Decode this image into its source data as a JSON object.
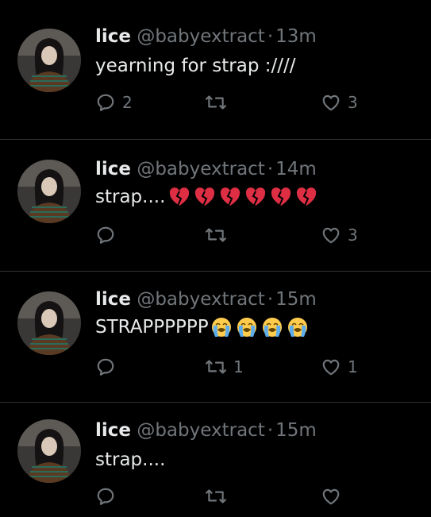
{
  "colors": {
    "background": "#000000",
    "text": "#e7e9ea",
    "muted": "#71767b",
    "divider": "#2f3336"
  },
  "tweets": [
    {
      "name": "lice",
      "handle": "@babyextract",
      "separator": "·",
      "time": "13m",
      "text": "yearning for strap :////",
      "emojis": [],
      "reply_count": "2",
      "retweet_count": "",
      "like_count": "3"
    },
    {
      "name": "lice",
      "handle": "@babyextract",
      "separator": "·",
      "time": "14m",
      "text": "strap....",
      "emojis": [
        "broken-heart",
        "broken-heart",
        "broken-heart",
        "broken-heart",
        "broken-heart",
        "broken-heart"
      ],
      "reply_count": "",
      "retweet_count": "",
      "like_count": "3"
    },
    {
      "name": "lice",
      "handle": "@babyextract",
      "separator": "·",
      "time": "15m",
      "text": "STRAPPPPPP",
      "emojis": [
        "loudly-crying-face",
        "loudly-crying-face",
        "loudly-crying-face",
        "loudly-crying-face"
      ],
      "reply_count": "",
      "retweet_count": "1",
      "like_count": "1"
    },
    {
      "name": "lice",
      "handle": "@babyextract",
      "separator": "·",
      "time": "15m",
      "text": "strap....",
      "emojis": [],
      "reply_count": "",
      "retweet_count": "",
      "like_count": ""
    }
  ]
}
